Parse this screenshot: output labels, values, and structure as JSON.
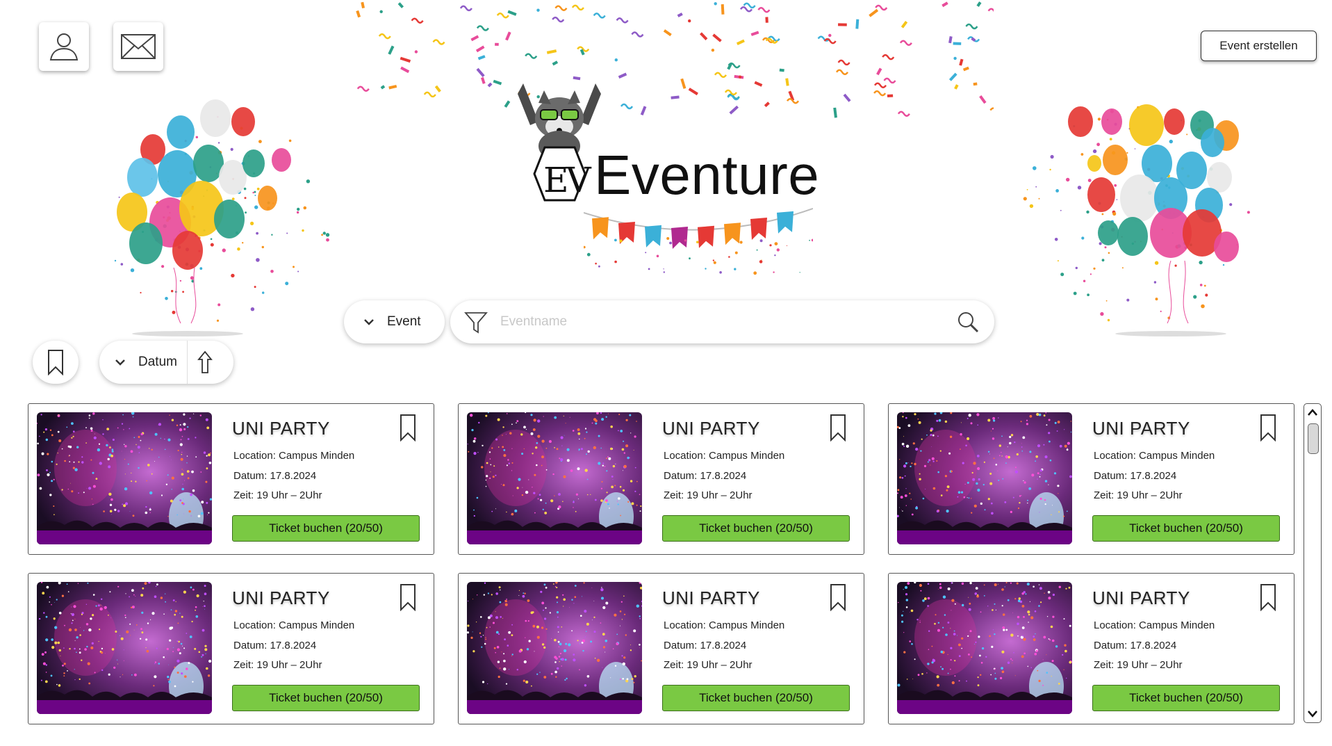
{
  "header": {
    "create_event_label": "Event erstellen",
    "profile_icon": "user-icon",
    "messages_icon": "envelope-icon"
  },
  "logo": {
    "mark": "EV",
    "title": "Eventure"
  },
  "filters": {
    "category_label": "Event",
    "search_placeholder": "Eventname",
    "sort_label": "Datum"
  },
  "colors": {
    "buy_button": "#7ac943",
    "accent_dark": "#222222"
  },
  "events": [
    {
      "title": "UNI PARTY",
      "location": "Location: Campus Minden",
      "date": "Datum: 17.8.2024",
      "time": "Zeit: 19 Uhr – 2Uhr",
      "button": "Ticket buchen (20/50)"
    },
    {
      "title": "UNI PARTY",
      "location": "Location: Campus Minden",
      "date": "Datum: 17.8.2024",
      "time": "Zeit: 19 Uhr – 2Uhr",
      "button": "Ticket buchen (20/50)"
    },
    {
      "title": "UNI PARTY",
      "location": "Location: Campus Minden",
      "date": "Datum: 17.8.2024",
      "time": "Zeit: 19 Uhr – 2Uhr",
      "button": "Ticket buchen (20/50)"
    },
    {
      "title": "UNI PARTY",
      "location": "Location: Campus Minden",
      "date": "Datum: 17.8.2024",
      "time": "Zeit: 19 Uhr – 2Uhr",
      "button": "Ticket buchen (20/50)"
    },
    {
      "title": "UNI PARTY",
      "location": "Location: Campus Minden",
      "date": "Datum: 17.8.2024",
      "time": "Zeit: 19 Uhr – 2Uhr",
      "button": "Ticket buchen (20/50)"
    },
    {
      "title": "UNI PARTY",
      "location": "Location: Campus Minden",
      "date": "Datum: 17.8.2024",
      "time": "Zeit: 19 Uhr – 2Uhr",
      "button": "Ticket buchen (20/50)"
    }
  ]
}
